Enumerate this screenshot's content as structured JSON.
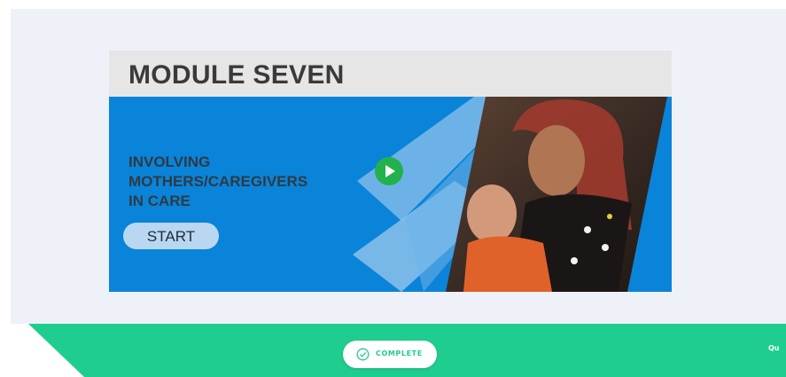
{
  "module": {
    "title": "MODULE SEVEN",
    "subtitle_lines": [
      "INVOLVING",
      "MOTHERS/CAREGIVERS",
      "IN CARE"
    ],
    "start_label": "START"
  },
  "icons": {
    "play": "play-icon",
    "complete": "check-circle-icon"
  },
  "footer": {
    "complete_label": "COMPLETE",
    "right_text": "Qu"
  },
  "colors": {
    "page_bg": "#eff1f9",
    "banner_blue": "#0a84d8",
    "header_gray": "#e6e6e6",
    "footer_green": "#1fce8f",
    "play_green": "#23b14d",
    "start_button": "#b9d7f1"
  }
}
